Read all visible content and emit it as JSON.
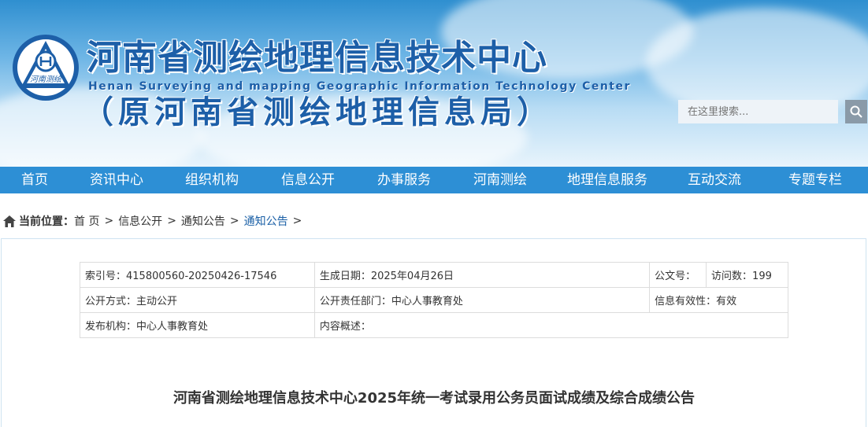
{
  "header": {
    "title_cn": "河南省测绘地理信息技术中心",
    "title_en": "Henan Surveying and mapping Geographic Information Technology Center",
    "title_sub": "（原河南省测绘地理信息局）",
    "logo_text": "河南测绘",
    "logo_icon": "hexagon-h-emblem",
    "search": {
      "placeholder": "在这里搜索...",
      "icon": "search-icon"
    }
  },
  "nav": {
    "items": [
      "首页",
      "资讯中心",
      "组织机构",
      "信息公开",
      "办事服务",
      "河南测绘",
      "地理信息服务",
      "互动交流",
      "专题专栏"
    ]
  },
  "breadcrumb": {
    "icon": "home-icon",
    "label": "当前位置：",
    "items": [
      "首 页",
      "信息公开",
      "通知公告",
      "通知公告"
    ],
    "separator": ">"
  },
  "meta": {
    "index_no": "索引号：415800560-20250426-17546",
    "date": "生成日期：2025年04月26日",
    "doc_no": "公文号：",
    "visits": "访问数：199",
    "open_mode": "公开方式：主动公开",
    "dept": "公开责任部门：中心人事教育处",
    "validity": "信息有效性：有效",
    "publisher": "发布机构：中心人事教育处",
    "summary": "内容概述："
  },
  "article": {
    "title": "河南省测绘地理信息技术中心2025年统一考试录用公务员面试成绩及综合成绩公告"
  },
  "colors": {
    "nav_bg": "#2d8fd5",
    "title_blue": "#1d5fa8",
    "link_blue": "#1a5fa6"
  }
}
